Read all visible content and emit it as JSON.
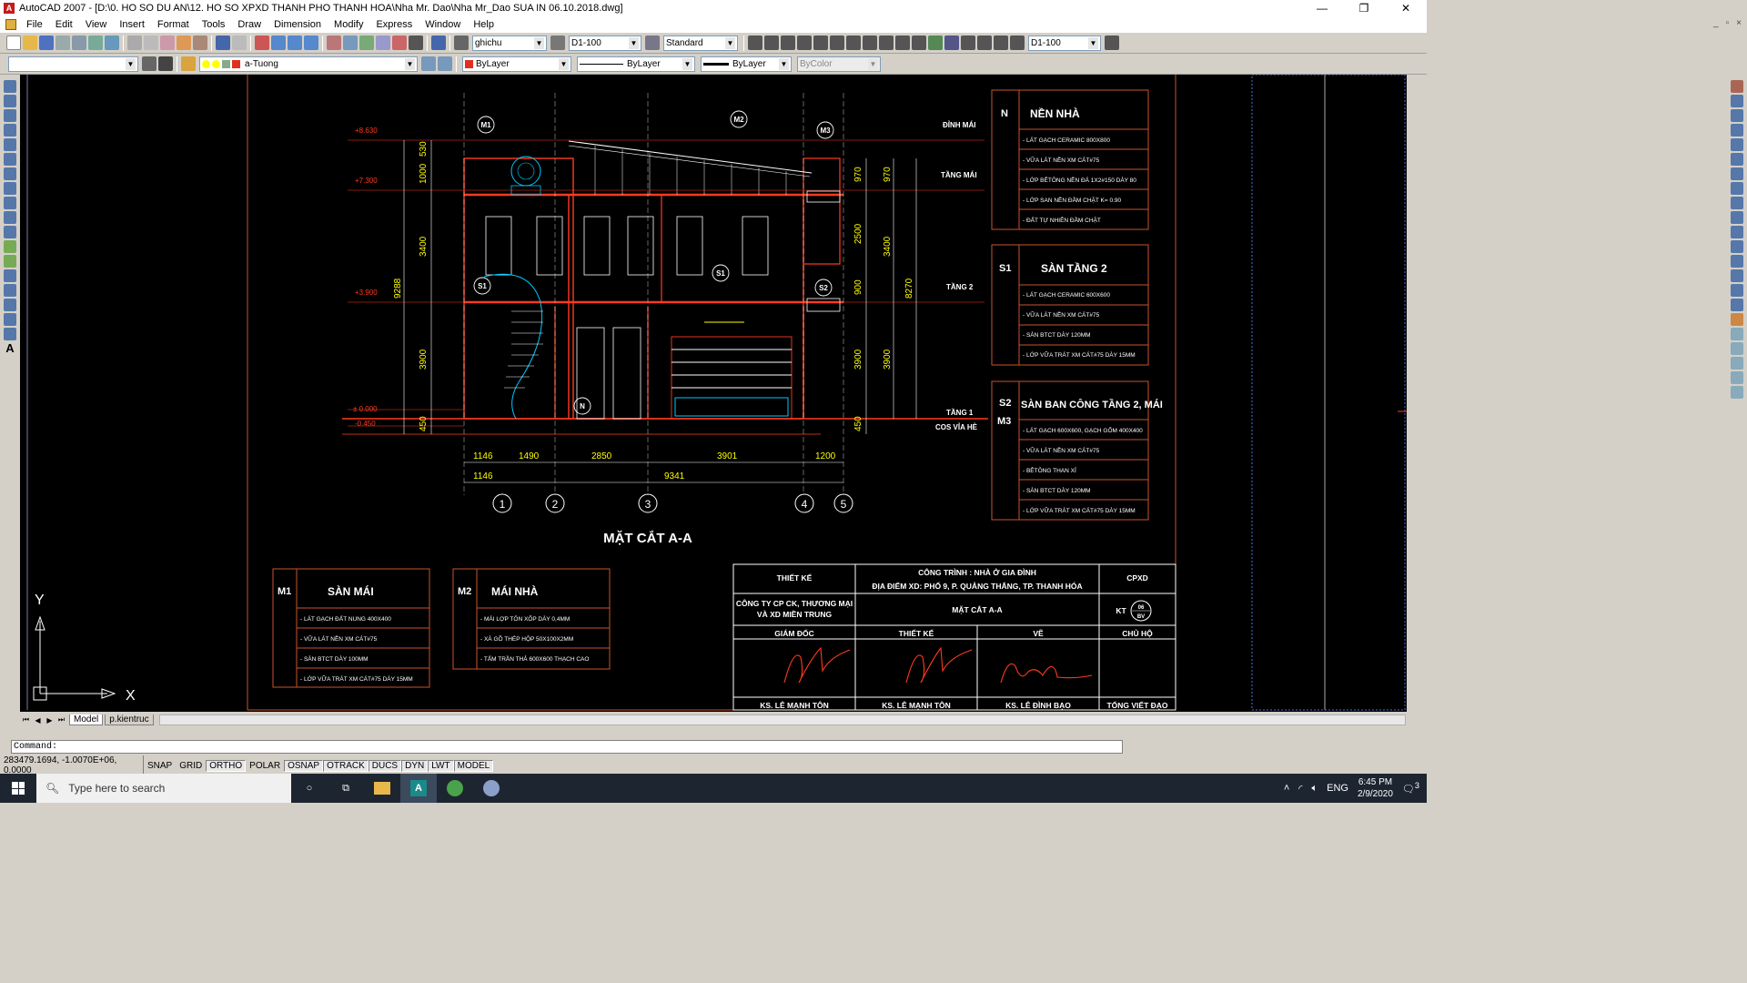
{
  "window": {
    "title": "AutoCAD 2007 - [D:\\0. HO SO DU AN\\12. HO SO XPXD THANH PHO THANH HOA\\Nha Mr. Dao\\Nha Mr_Dao SUA IN 06.10.2018.dwg]",
    "controls": [
      "—",
      "❐",
      "✕"
    ],
    "mdi_controls": [
      "_",
      "▫",
      "×"
    ]
  },
  "menu": [
    "File",
    "Edit",
    "View",
    "Insert",
    "Format",
    "Tools",
    "Draw",
    "Dimension",
    "Modify",
    "Express",
    "Window",
    "Help"
  ],
  "toolbar": {
    "text_style": "ghichu",
    "dim_style": "D1-100",
    "table_style": "Standard",
    "dim_style2": "D1-100",
    "layer": "a-Tuong",
    "color": "ByLayer",
    "linetype": "ByLayer",
    "lineweight": "ByLayer",
    "plotstyle": "ByColor",
    "layer_prev": ""
  },
  "drawing": {
    "section_title": "MẶT CẮT A-A",
    "levels_left": [
      "+8.630",
      "+7.300",
      "+3.900",
      "± 0.000",
      "-0.450"
    ],
    "dims_left": [
      "530",
      "1000",
      "3400",
      "9288",
      "3900",
      "450"
    ],
    "dims_right_a": [
      "970",
      "2500",
      "900",
      "3900",
      "450"
    ],
    "dims_right_b": [
      "970",
      "3400",
      "8270",
      "3900"
    ],
    "floor_labels": [
      "ĐỈNH MÁI",
      "TẦNG MÁI",
      "TẦNG 2",
      "TẦNG 1",
      "COS VỈA HÈ"
    ],
    "dims_bottom1": [
      "1146",
      "1490",
      "2850",
      "3901",
      "1200"
    ],
    "dims_bottom2": [
      "1146",
      "9341"
    ],
    "axes": [
      "1",
      "2",
      "3",
      "4",
      "5"
    ],
    "callouts": [
      "M1",
      "M2",
      "M3",
      "S1",
      "S1",
      "S2",
      "N"
    ],
    "legend_right": [
      {
        "code": "N",
        "title": "NỀN NHÀ",
        "items": [
          "- LÁT GẠCH CERAMIC 800X800",
          "- VỮA LÁT NỀN XM CÁT#75",
          "- LỚP BÊTÔNG NỀN ĐÁ 1X2#150 DÀY 80",
          "- LỚP SAN NỀN ĐẦM CHẶT K= 0.90",
          "- ĐẤT TỰ NHIÊN ĐẦM CHẶT"
        ]
      },
      {
        "code": "S1",
        "title": "SÀN TẦNG 2",
        "items": [
          "- LÁT GẠCH CERAMIC 600X600",
          "- VỮA LÁT NỀN XM CÁT#75",
          "- SÀN BTCT DÀY 120MM",
          "- LỚP VỮA TRÁT XM CÁT#75 DÀY 15MM"
        ]
      },
      {
        "code": "S2",
        "code2": "M3",
        "title": "SÀN BAN CÔNG TẦNG 2, MÁI",
        "items": [
          "- LÁT GẠCH 600X600, GẠCH GỐM 400X400",
          "- VỮA LÁT NỀN XM CÁT#75",
          "- BÊTÔNG THAN XỈ",
          "- SÀN BTCT DÀY 120MM",
          "- LỚP VỮA TRÁT XM CÁT#75 DÀY 15MM"
        ]
      }
    ],
    "legend_bottom": [
      {
        "code": "M1",
        "title": "SÀN MÁI",
        "items": [
          "- LÁT GẠCH ĐẤT NUNG 400X400",
          "- VỮA LÁT NỀN XM CÁT#75",
          "- SÀN BTCT DÀY 100MM",
          "- LỚP VỮA TRÁT XM CÁT#75 DÀY 15MM"
        ]
      },
      {
        "code": "M2",
        "title": "MÁI NHÀ",
        "items": [
          "- MÁI LỢP TÔN XỐP DÀY 0,4MM",
          "- XÀ GỒ THÉP HỘP 50X100X2MM",
          "- TẤM TRẦN THẢ 600X600 THẠCH CAO"
        ]
      }
    ],
    "title_block": {
      "design": "THIẾT KẾ",
      "project": "CÔNG TRÌNH : NHÀ Ở GIA ĐÌNH",
      "location": "ĐỊA ĐIỂM XD:  PHỐ 9, P. QUẢNG THẮNG, TP. THANH HÓA",
      "cpxd": "CPXD",
      "company_1": "CÔNG TY CP CK, THƯƠNG MẠI",
      "company_2": "VÀ XD MIỀN TRUNG",
      "sheet_title": "MẶT CẮT A-A",
      "kt": "KT",
      "sheet_no": "06",
      "sheet_of": "BV",
      "director": "GIÁM ĐỐC",
      "designer": "THIẾT KẾ",
      "drafter": "VẼ",
      "owner": "CHỦ HỘ",
      "name_director": "KS. LÊ MẠNH TÔN",
      "name_designer": "KS. LÊ MẠNH TÔN",
      "name_drafter": "KS. LÊ ĐÌNH BẠO",
      "name_owner": "TỐNG VIẾT ĐẠO"
    },
    "ucs": {
      "x": "X",
      "y": "Y"
    }
  },
  "tabs": {
    "model": "Model",
    "layout": "p.kientruc"
  },
  "command": {
    "prompt": "Command:"
  },
  "status": {
    "coords": "283479.1694, -1.0070E+06, 0.0000",
    "buttons": [
      "SNAP",
      "GRID",
      "ORTHO",
      "POLAR",
      "OSNAP",
      "OTRACK",
      "DUCS",
      "DYN",
      "LWT",
      "MODEL"
    ],
    "pressed": [
      "ORTHO",
      "OSNAP",
      "OTRACK",
      "DUCS",
      "DYN",
      "LWT",
      "MODEL"
    ]
  },
  "taskbar": {
    "search_placeholder": "Type here to search",
    "lang": "ENG",
    "time": "6:45 PM",
    "date": "2/9/2020",
    "notifications": "3"
  },
  "colors": {
    "canvas": "#000000",
    "wall": "#ff3b1e",
    "dim": "#ffff00",
    "text": "#ffffff",
    "frame": "#c8532b",
    "cyan": "#00c8ff"
  }
}
